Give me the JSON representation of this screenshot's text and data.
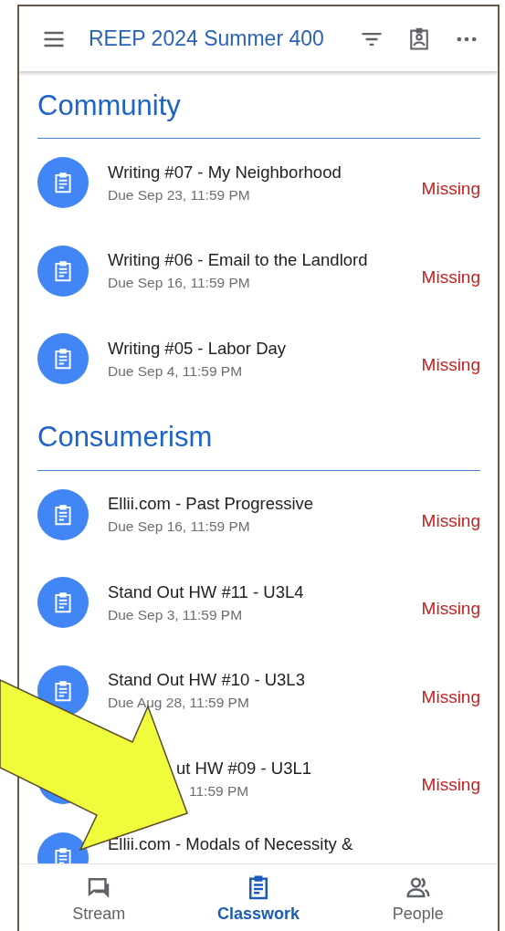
{
  "app_bar": {
    "title": "REEP 2024 Summer 400"
  },
  "sections": [
    {
      "heading": "Community",
      "assignments": [
        {
          "title": "Writing #07 - My Neighborhood",
          "due": "Due Sep 23, 11:59 PM",
          "status": "Missing",
          "covered": false
        },
        {
          "title": "Writing #06 - Email to the Landlord",
          "due": "Due Sep 16, 11:59 PM",
          "status": "Missing",
          "covered": false
        },
        {
          "title": "Writing #05 - Labor Day",
          "due": "Due Sep 4, 11:59 PM",
          "status": "Missing",
          "covered": false
        }
      ]
    },
    {
      "heading": "Consumerism",
      "assignments": [
        {
          "title": "Ellii.com - Past Progressive",
          "due": "Due Sep 16, 11:59 PM",
          "status": "Missing",
          "covered": false
        },
        {
          "title": "Stand Out HW #11 - U3L4",
          "due": "Due Sep 3, 11:59 PM",
          "status": "Missing",
          "covered": false
        },
        {
          "title": "Stand Out HW #10 - U3L3",
          "due": "Due Aug 28, 11:59 PM",
          "status": "Missing",
          "covered": false
        },
        {
          "title": "ut HW #09 - U3L1",
          "due": "11:59 PM",
          "status": "Missing",
          "covered": true
        },
        {
          "title": "Ellii.com - Modals of Necessity &",
          "covered": false
        }
      ]
    }
  ],
  "bottom_nav": [
    {
      "label": "Stream",
      "selected": false,
      "kind": "stream"
    },
    {
      "label": "Classwork",
      "selected": true,
      "kind": "classwork"
    },
    {
      "label": "People",
      "selected": false,
      "kind": "people"
    }
  ]
}
